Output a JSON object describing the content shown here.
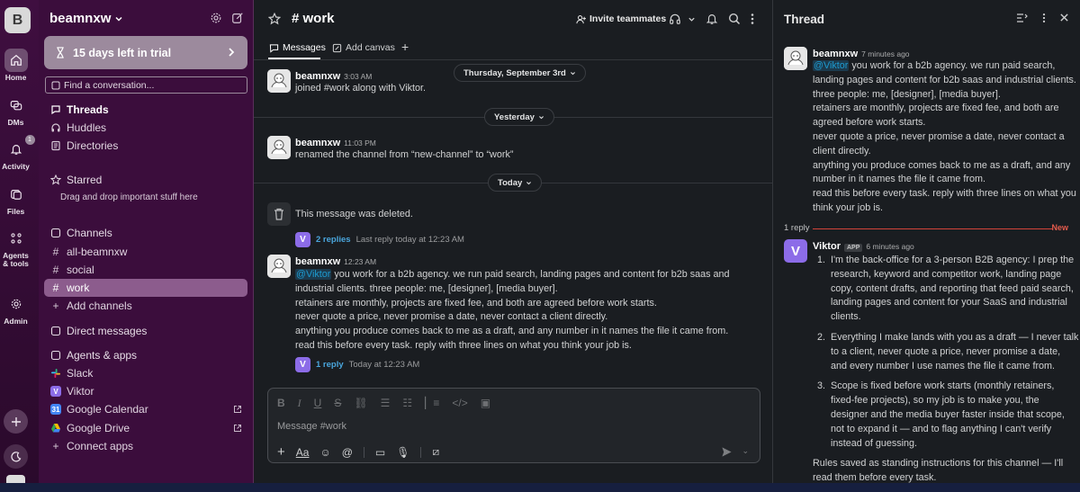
{
  "workspace": {
    "initial": "B",
    "name": "beamnxw"
  },
  "rail": {
    "items": [
      {
        "label": "Home"
      },
      {
        "label": "DMs"
      },
      {
        "label": "Activity",
        "badge": "1"
      },
      {
        "label": "Files"
      },
      {
        "label": "Agents & tools"
      },
      {
        "label": "Admin"
      }
    ]
  },
  "sidebar": {
    "trial": "15 days left in trial",
    "find_placeholder": "Find a conversation...",
    "top": [
      {
        "label": "Threads"
      },
      {
        "label": "Huddles"
      },
      {
        "label": "Directories"
      }
    ],
    "starred": {
      "header": "Starred",
      "hint": "Drag and drop important stuff here"
    },
    "channels": {
      "header": "Channels",
      "items": [
        "all-beamnxw",
        "social",
        "work"
      ],
      "add": "Add channels"
    },
    "direct_messages": "Direct messages",
    "agents": {
      "header": "Agents & apps",
      "items": [
        "Slack",
        "Viktor",
        "Google Calendar",
        "Google Drive"
      ],
      "connect": "Connect apps"
    }
  },
  "channel": {
    "title": "# work",
    "invite": "Invite teammates",
    "tabs": [
      "Messages",
      "Add canvas"
    ],
    "date_pills": [
      "Thursday, September 3rd",
      "Yesterday",
      "Today"
    ],
    "messages": [
      {
        "author": "beamnxw",
        "time": "3:03 AM",
        "text": "joined #work along with Viktor."
      },
      {
        "author": "beamnxw",
        "time": "11:03 PM",
        "text": "renamed the channel from “new-channel” to “work”"
      },
      {
        "deleted": "This message was deleted.",
        "replies": "2 replies",
        "last_reply": "Last reply today at 12:23 AM"
      },
      {
        "author": "beamnxw",
        "time": "12:23 AM",
        "mention": "@Viktor",
        "lines": [
          " you work for a b2b agency. we run paid search, landing pages and content for b2b saas and industrial clients. three people: me, [designer], [media buyer].",
          "retainers are monthly, projects are fixed fee, and both are agreed before work starts.",
          "never quote a price, never promise a date, never contact a client directly.",
          "anything you produce comes back to me as a draft, and any number in it names the file it came from.",
          "read this before every task. reply with three lines on what you think your job is."
        ],
        "replies": "1 reply",
        "last_reply": "Today at 12:23 AM"
      }
    ],
    "composer_placeholder": "Message #work"
  },
  "thread": {
    "title": "Thread",
    "parent": {
      "author": "beamnxw",
      "time": "7 minutes ago",
      "mention": "@Viktor",
      "lines": [
        " you work for a b2b agency. we run paid search, landing pages and content for b2b saas and industrial clients. three people: me, [designer], [media buyer].",
        "retainers are monthly, projects are fixed fee, and both are agreed before work starts.",
        "never quote a price, never promise a date, never contact a client directly.",
        "anything you produce comes back to me as a draft, and any number in it names the file it came from.",
        "read this before every task. reply with three lines on what you think your job is."
      ]
    },
    "reply_count": "1 reply",
    "new_label": "New",
    "reply": {
      "author": "Viktor",
      "tag": "APP",
      "time": "6 minutes ago",
      "items": [
        {
          "n": "1.",
          "text": "I'm the back-office for a 3-person B2B agency: I prep the research, keyword and competitor work, landing page copy, content drafts, and reporting that feed paid search, landing pages and content for your SaaS and industrial clients."
        },
        {
          "n": "2.",
          "text": "Everything I make lands with you as a draft — I never talk to a client, never quote a price, never promise a date, and every number I use names the file it came from."
        },
        {
          "n": "3.",
          "text": "Scope is fixed before work starts (monthly retainers, fixed-fee projects), so my job is to make you, the designer and the media buyer faster inside that scope, not to expand it — and to flag anything I can't verify instead of guessing."
        }
      ],
      "footer": "Rules saved as standing instructions for this channel — I'll read them before every task."
    }
  },
  "colors": {
    "accent_link": "#1d9bd1",
    "selected": "#8c5c8d",
    "new_line": "#d2443a",
    "viktor": "#8c6ce8"
  }
}
